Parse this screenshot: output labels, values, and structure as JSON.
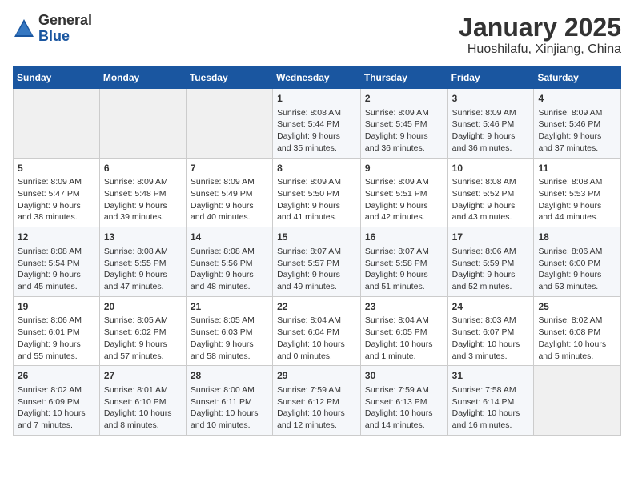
{
  "header": {
    "logo_general": "General",
    "logo_blue": "Blue",
    "title": "January 2025",
    "subtitle": "Huoshilafu, Xinjiang, China"
  },
  "days_of_week": [
    "Sunday",
    "Monday",
    "Tuesday",
    "Wednesday",
    "Thursday",
    "Friday",
    "Saturday"
  ],
  "weeks": [
    [
      {
        "day": "",
        "info": ""
      },
      {
        "day": "",
        "info": ""
      },
      {
        "day": "",
        "info": ""
      },
      {
        "day": "1",
        "info": "Sunrise: 8:08 AM\nSunset: 5:44 PM\nDaylight: 9 hours\nand 35 minutes."
      },
      {
        "day": "2",
        "info": "Sunrise: 8:09 AM\nSunset: 5:45 PM\nDaylight: 9 hours\nand 36 minutes."
      },
      {
        "day": "3",
        "info": "Sunrise: 8:09 AM\nSunset: 5:46 PM\nDaylight: 9 hours\nand 36 minutes."
      },
      {
        "day": "4",
        "info": "Sunrise: 8:09 AM\nSunset: 5:46 PM\nDaylight: 9 hours\nand 37 minutes."
      }
    ],
    [
      {
        "day": "5",
        "info": "Sunrise: 8:09 AM\nSunset: 5:47 PM\nDaylight: 9 hours\nand 38 minutes."
      },
      {
        "day": "6",
        "info": "Sunrise: 8:09 AM\nSunset: 5:48 PM\nDaylight: 9 hours\nand 39 minutes."
      },
      {
        "day": "7",
        "info": "Sunrise: 8:09 AM\nSunset: 5:49 PM\nDaylight: 9 hours\nand 40 minutes."
      },
      {
        "day": "8",
        "info": "Sunrise: 8:09 AM\nSunset: 5:50 PM\nDaylight: 9 hours\nand 41 minutes."
      },
      {
        "day": "9",
        "info": "Sunrise: 8:09 AM\nSunset: 5:51 PM\nDaylight: 9 hours\nand 42 minutes."
      },
      {
        "day": "10",
        "info": "Sunrise: 8:08 AM\nSunset: 5:52 PM\nDaylight: 9 hours\nand 43 minutes."
      },
      {
        "day": "11",
        "info": "Sunrise: 8:08 AM\nSunset: 5:53 PM\nDaylight: 9 hours\nand 44 minutes."
      }
    ],
    [
      {
        "day": "12",
        "info": "Sunrise: 8:08 AM\nSunset: 5:54 PM\nDaylight: 9 hours\nand 45 minutes."
      },
      {
        "day": "13",
        "info": "Sunrise: 8:08 AM\nSunset: 5:55 PM\nDaylight: 9 hours\nand 47 minutes."
      },
      {
        "day": "14",
        "info": "Sunrise: 8:08 AM\nSunset: 5:56 PM\nDaylight: 9 hours\nand 48 minutes."
      },
      {
        "day": "15",
        "info": "Sunrise: 8:07 AM\nSunset: 5:57 PM\nDaylight: 9 hours\nand 49 minutes."
      },
      {
        "day": "16",
        "info": "Sunrise: 8:07 AM\nSunset: 5:58 PM\nDaylight: 9 hours\nand 51 minutes."
      },
      {
        "day": "17",
        "info": "Sunrise: 8:06 AM\nSunset: 5:59 PM\nDaylight: 9 hours\nand 52 minutes."
      },
      {
        "day": "18",
        "info": "Sunrise: 8:06 AM\nSunset: 6:00 PM\nDaylight: 9 hours\nand 53 minutes."
      }
    ],
    [
      {
        "day": "19",
        "info": "Sunrise: 8:06 AM\nSunset: 6:01 PM\nDaylight: 9 hours\nand 55 minutes."
      },
      {
        "day": "20",
        "info": "Sunrise: 8:05 AM\nSunset: 6:02 PM\nDaylight: 9 hours\nand 57 minutes."
      },
      {
        "day": "21",
        "info": "Sunrise: 8:05 AM\nSunset: 6:03 PM\nDaylight: 9 hours\nand 58 minutes."
      },
      {
        "day": "22",
        "info": "Sunrise: 8:04 AM\nSunset: 6:04 PM\nDaylight: 10 hours\nand 0 minutes."
      },
      {
        "day": "23",
        "info": "Sunrise: 8:04 AM\nSunset: 6:05 PM\nDaylight: 10 hours\nand 1 minute."
      },
      {
        "day": "24",
        "info": "Sunrise: 8:03 AM\nSunset: 6:07 PM\nDaylight: 10 hours\nand 3 minutes."
      },
      {
        "day": "25",
        "info": "Sunrise: 8:02 AM\nSunset: 6:08 PM\nDaylight: 10 hours\nand 5 minutes."
      }
    ],
    [
      {
        "day": "26",
        "info": "Sunrise: 8:02 AM\nSunset: 6:09 PM\nDaylight: 10 hours\nand 7 minutes."
      },
      {
        "day": "27",
        "info": "Sunrise: 8:01 AM\nSunset: 6:10 PM\nDaylight: 10 hours\nand 8 minutes."
      },
      {
        "day": "28",
        "info": "Sunrise: 8:00 AM\nSunset: 6:11 PM\nDaylight: 10 hours\nand 10 minutes."
      },
      {
        "day": "29",
        "info": "Sunrise: 7:59 AM\nSunset: 6:12 PM\nDaylight: 10 hours\nand 12 minutes."
      },
      {
        "day": "30",
        "info": "Sunrise: 7:59 AM\nSunset: 6:13 PM\nDaylight: 10 hours\nand 14 minutes."
      },
      {
        "day": "31",
        "info": "Sunrise: 7:58 AM\nSunset: 6:14 PM\nDaylight: 10 hours\nand 16 minutes."
      },
      {
        "day": "",
        "info": ""
      }
    ]
  ]
}
